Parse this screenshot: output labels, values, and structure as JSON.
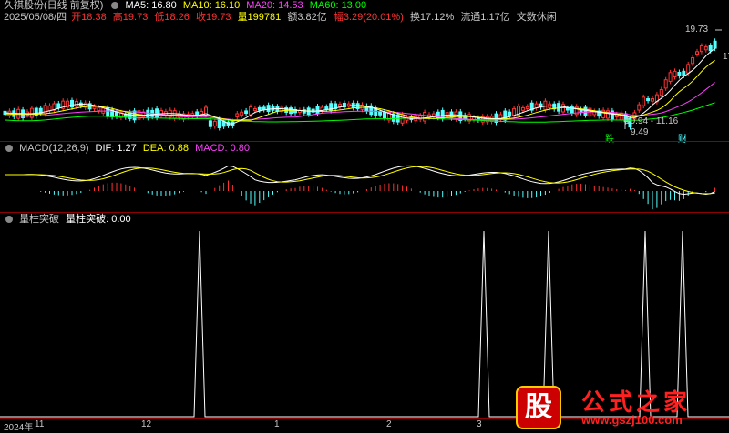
{
  "header": {
    "title": "久祺股份(日线 前复权)",
    "ma": [
      {
        "label": "MA5: 16.80",
        "color": "#ffffff"
      },
      {
        "label": "MA10: 16.10",
        "color": "#ffff00"
      },
      {
        "label": "MA20: 14.53",
        "color": "#ff40ff"
      },
      {
        "label": "MA60: 13.00",
        "color": "#00ff00"
      }
    ]
  },
  "info": {
    "date": "2025/05/08/四",
    "open": "开18.38",
    "high": "高19.73",
    "low": "低18.26",
    "close": "收19.73",
    "volume": "量199781",
    "amount": "额3.82亿",
    "change": "幅3.29(20.01%)",
    "turnover": "换17.12%",
    "float": "流通1.17亿",
    "note": "文数休闲"
  },
  "price_annotations": {
    "high_label": "19.73",
    "right_label": "17",
    "range_label": "10.94 - 11.16",
    "low_label": "9.49",
    "tag_fall": "跌",
    "tag_fin": "财"
  },
  "macd": {
    "title": "MACD(12,26,9)",
    "dif": "DIF: 1.27",
    "dea": "DEA: 0.88",
    "macd": "MACD: 0.80"
  },
  "vol_break": {
    "title": "量柱突破",
    "value": "量柱突破: 0.00"
  },
  "x_axis": [
    "2024年",
    "11",
    "12",
    "1",
    "2",
    "3"
  ],
  "watermark": {
    "glyph": "股",
    "title": "公式之家",
    "url": "www.gszj100.com"
  },
  "colors": {
    "up": "#ff3232",
    "down": "#54ffff",
    "ma5": "#ffffff",
    "ma10": "#ffff00",
    "ma20": "#ff40ff",
    "ma60": "#00ff00"
  }
}
